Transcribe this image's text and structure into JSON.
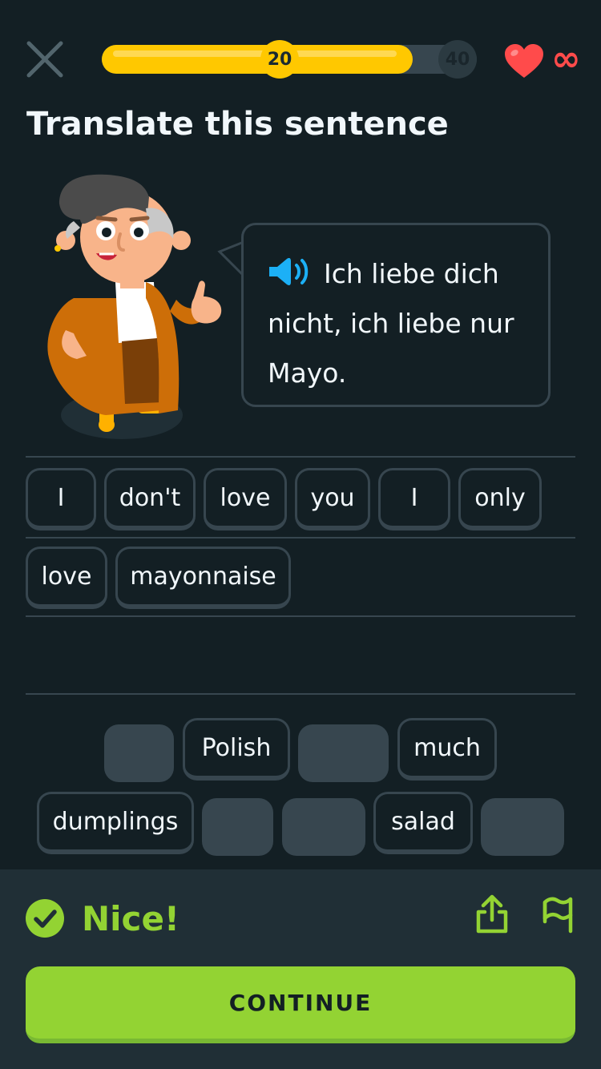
{
  "header": {
    "progress": {
      "current_label": "20",
      "goal_label": "40",
      "percent": 0.83
    },
    "hearts": {
      "count_label": "∞"
    }
  },
  "prompt": {
    "title": "Translate this sentence",
    "sentence": "Ich liebe dich nicht, ich liebe nur Mayo."
  },
  "answer": {
    "rows": [
      [
        "I",
        "don't",
        "love",
        "you",
        "I",
        "only"
      ],
      [
        "love",
        "mayonnaise"
      ]
    ]
  },
  "word_bank": {
    "row1": [
      "",
      "Polish",
      "",
      "much"
    ],
    "row2": [
      "dumplings",
      "",
      "",
      "salad",
      ""
    ]
  },
  "feedback": {
    "text": "Nice!"
  },
  "continue_button": {
    "label": "CONTINUE"
  },
  "colors": {
    "background": "#131f24",
    "footer": "#202f36",
    "progress": "#ffc800",
    "heart": "#ff4b4b",
    "success": "#93d333",
    "chip_border": "#37464f",
    "speaker": "#1cb0f6"
  },
  "icons": {
    "close": "close-icon",
    "heart": "heart-icon",
    "speaker": "speaker-icon",
    "check": "check-circle-icon",
    "share": "share-icon",
    "flag": "flag-icon"
  }
}
